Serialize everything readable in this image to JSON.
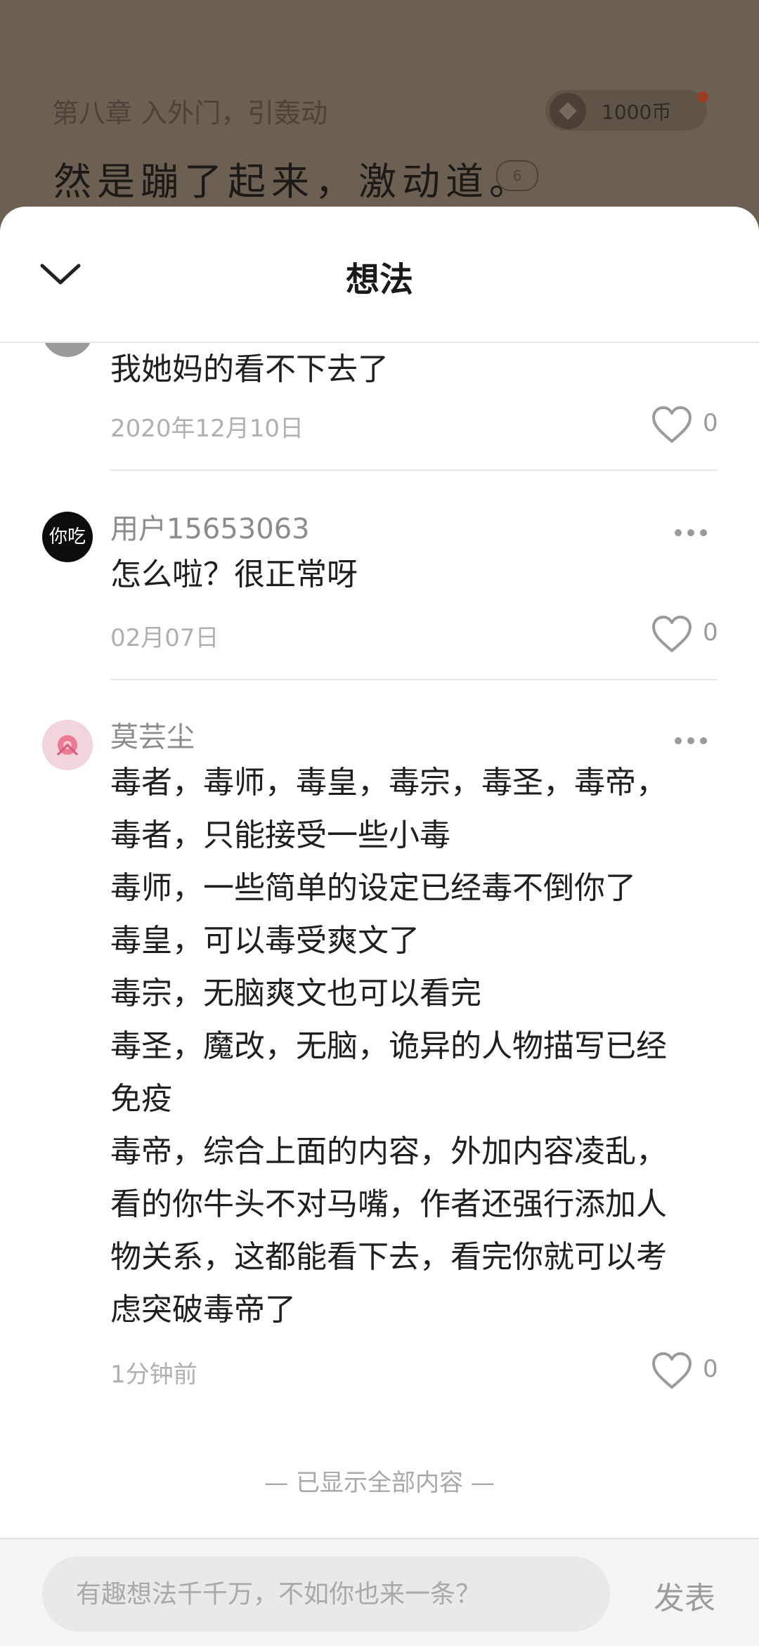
{
  "reader": {
    "chapter_title": "第八章 入外门，引轰动",
    "coins": "1000币",
    "text_line": "然是蹦了起来，激动道。",
    "comment_count": "6"
  },
  "sheet": {
    "title": "想法"
  },
  "comments": [
    {
      "name": "",
      "content": "我她妈的看不下去了",
      "date": "2020年12月10日",
      "likes": "0"
    },
    {
      "name": "用户15653063",
      "avatar_text": "你吃",
      "content": "怎么啦？很正常呀",
      "date": "02月07日",
      "likes": "0"
    },
    {
      "name": "莫芸尘",
      "content_lines": [
        "毒者，毒师，毒皇，毒宗，毒圣，毒帝，",
        "毒者，只能接受一些小毒",
        "毒师，一些简单的设定已经毒不倒你了",
        "毒皇，可以毒受爽文了",
        "毒宗，无脑爽文也可以看完",
        "毒圣，魔改，无脑，诡异的人物描写已经",
        "免疫",
        "毒帝，综合上面的内容，外加内容凌乱，",
        "看的你牛头不对马嘴，作者还强行添加人",
        "物关系，这都能看下去，看完你就可以考",
        "虑突破毒帝了"
      ],
      "date": "1分钟前",
      "likes": "0"
    }
  ],
  "footer_note": "—  已显示全部内容  —",
  "composer": {
    "placeholder": "有趣想法千千万，不如你也来一条？",
    "post_label": "发表"
  }
}
